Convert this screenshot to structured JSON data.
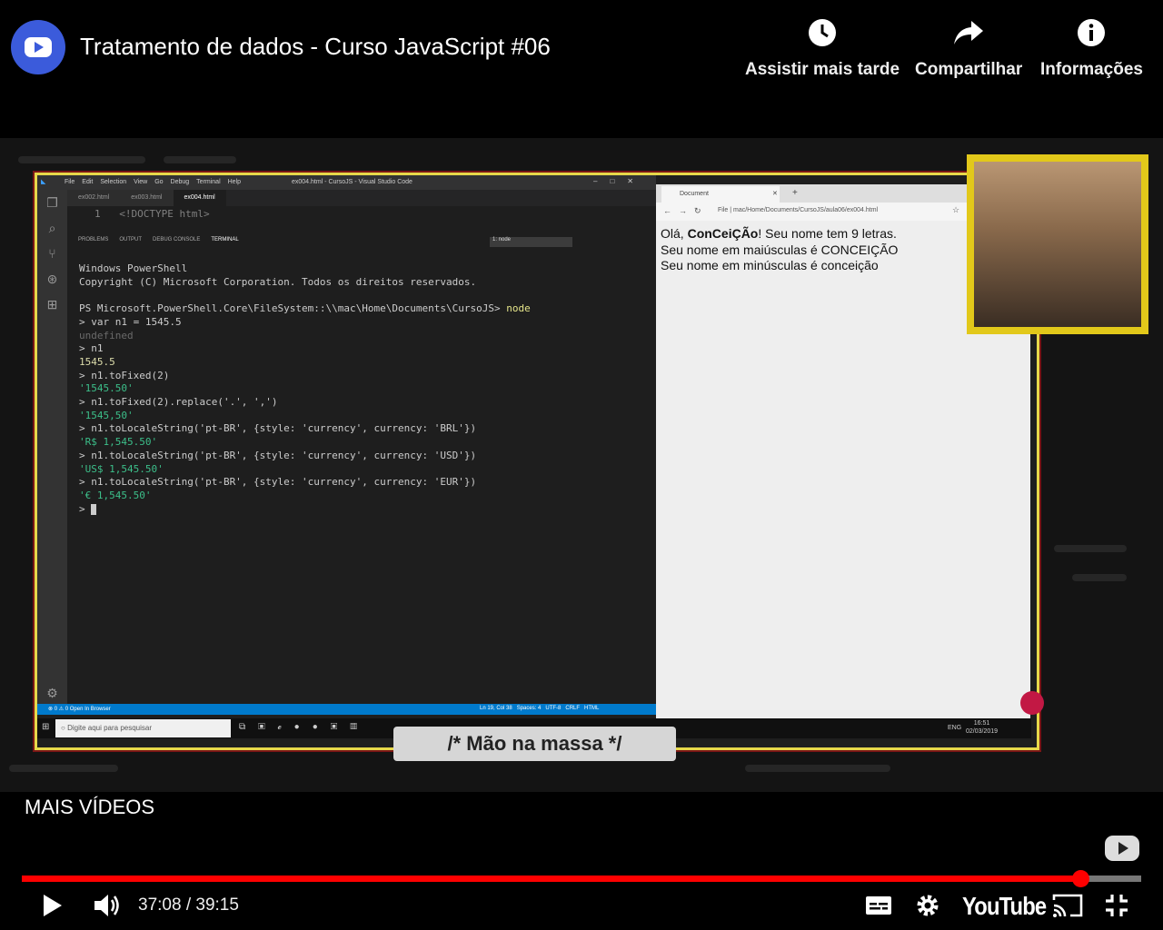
{
  "header": {
    "title": "Tratamento de dados - Curso JavaScript #06",
    "actions": {
      "watch_later": "Assistir mais tarde",
      "share": "Compartilhar",
      "info": "Informações"
    }
  },
  "video": {
    "vscode": {
      "menu": [
        "File",
        "Edit",
        "Selection",
        "View",
        "Go",
        "Debug",
        "Terminal",
        "Help"
      ],
      "window_title": "ex004.html - CursoJS - Visual Studio Code",
      "tabs": [
        "ex002.html",
        "ex003.html",
        "ex004.html"
      ],
      "code_line_number": "1",
      "code_line": "<!DOCTYPE html>",
      "panel_tabs": [
        "PROBLEMS",
        "OUTPUT",
        "DEBUG CONSOLE",
        "TERMINAL"
      ],
      "terminal_select": "1: node",
      "terminal": {
        "l1": "Windows PowerShell",
        "l2": "Copyright (C) Microsoft Corporation. Todos os direitos reservados.",
        "l3": "PS Microsoft.PowerShell.Core\\FileSystem::\\\\mac\\Home\\Documents\\CursoJS>",
        "l3b": " node",
        "l4": "> var n1 = 1545.5",
        "l5": "undefined",
        "l6": "> n1",
        "l7": "1545.5",
        "l8": "> n1.toFixed(2)",
        "l9": "'1545.50'",
        "l10": "> n1.toFixed(2).replace('.', ',')",
        "l11": "'1545,50'",
        "l12": "> n1.toLocaleString('pt-BR', {style: 'currency', currency: 'BRL'})",
        "l13": "'R$ 1,545.50'",
        "l14": "> n1.toLocaleString('pt-BR', {style: 'currency', currency: 'USD'})",
        "l15": "'US$ 1,545.50'",
        "l16": "> n1.toLocaleString('pt-BR', {style: 'currency', currency: 'EUR'})",
        "l17": "'€ 1,545.50'",
        "l18": "> "
      },
      "status_left": "⊗ 0 ⚠ 0   Open In Browser",
      "status_right": "Ln 19, Col 38   Spaces: 4   UTF-8   CRLF   HTML"
    },
    "browser": {
      "tab": "Document",
      "url": "File | mac/Home/Documents/CursoJS/aula06/ex004.html",
      "line1_pre": "Olá, ",
      "line1_name": "ConCeiÇÃo",
      "line1_post": "! Seu nome tem 9 letras.",
      "line2": "Seu nome em maiúsculas é CONCEIÇÃO",
      "line3": "Seu nome em minúsculas é conceição"
    },
    "taskbar": {
      "search_placeholder": "Digite aqui para pesquisar",
      "lang": "ENG",
      "time": "16:51",
      "date": "02/03/2019"
    },
    "banner": "/* Mão na massa */"
  },
  "controls": {
    "more_videos": "MAIS VÍDEOS",
    "time": "37:08 / 39:15",
    "progress_fraction": 0.9458,
    "logo": "YouTube",
    "accent_color": "#ff0000"
  }
}
